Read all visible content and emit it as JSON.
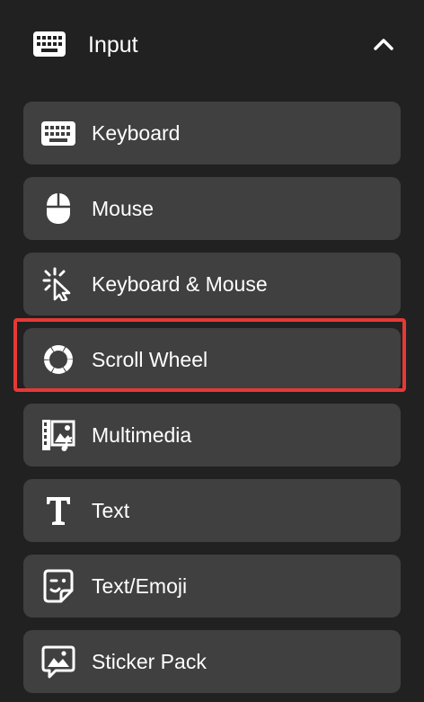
{
  "header": {
    "label": "Input",
    "icon": "keyboard-icon",
    "toggle_icon": "chevron-up-icon"
  },
  "items": [
    {
      "label": "Keyboard",
      "icon": "keyboard-icon"
    },
    {
      "label": "Mouse",
      "icon": "mouse-icon"
    },
    {
      "label": "Keyboard & Mouse",
      "icon": "click-cursor-icon"
    },
    {
      "label": "Scroll Wheel",
      "icon": "scroll-wheel-icon",
      "highlighted": true
    },
    {
      "label": "Multimedia",
      "icon": "multimedia-icon"
    },
    {
      "label": "Text",
      "icon": "text-icon"
    },
    {
      "label": "Text/Emoji",
      "icon": "emoji-icon"
    },
    {
      "label": "Sticker Pack",
      "icon": "sticker-pack-icon"
    }
  ],
  "colors": {
    "background": "#212121",
    "item_background": "#404040",
    "highlight": "#e53935",
    "text": "#ffffff"
  }
}
